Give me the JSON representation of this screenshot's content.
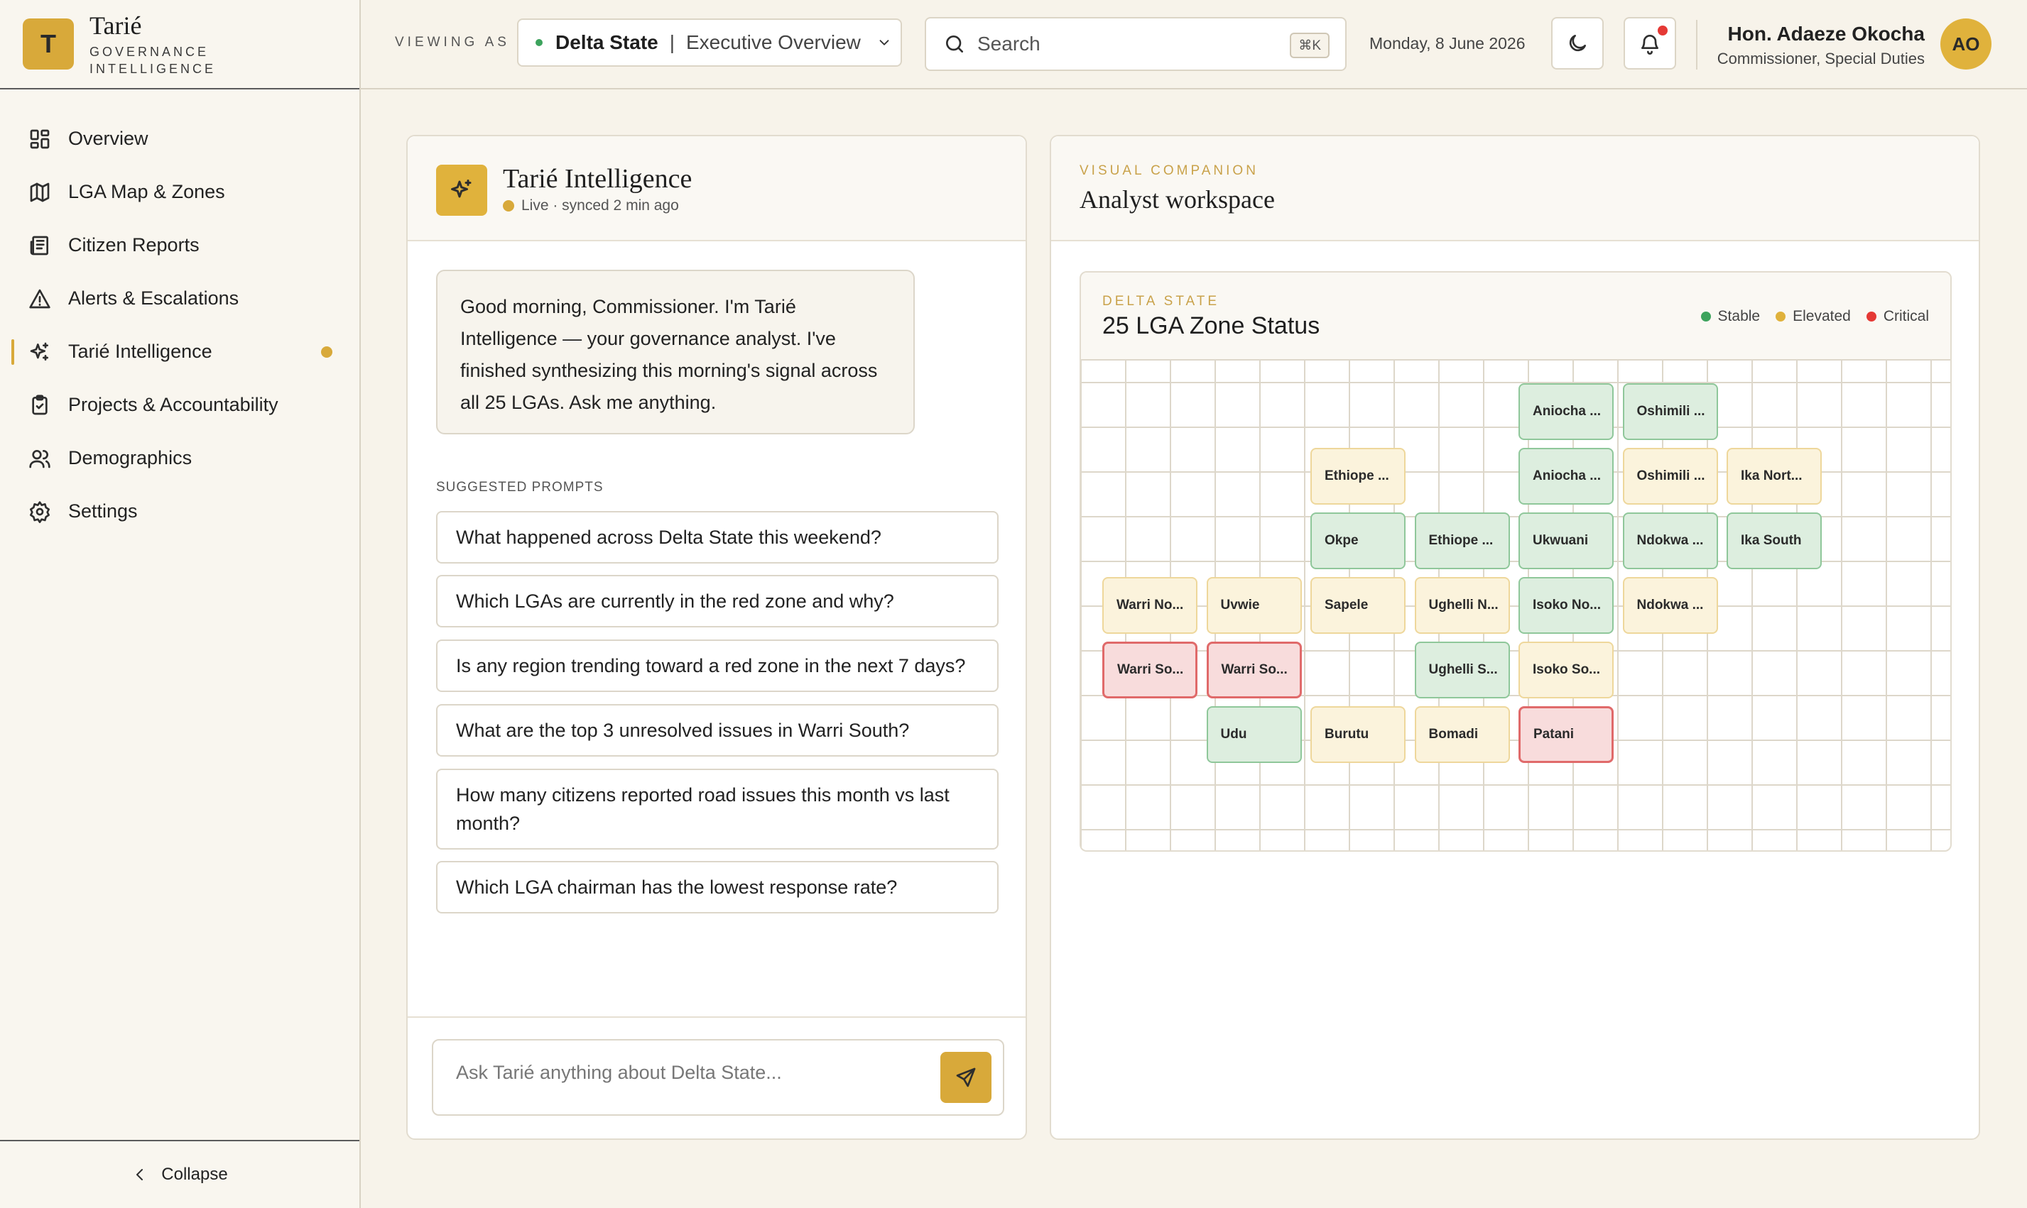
{
  "app": {
    "brand_initial": "T",
    "brand_name": "Tarié",
    "brand_sub": "GOVERNANCE INTELLIGENCE"
  },
  "sidebar": {
    "items": [
      {
        "label": "Overview",
        "icon": "dashboard-grid-icon"
      },
      {
        "label": "LGA Map & Zones",
        "icon": "map-icon"
      },
      {
        "label": "Citizen Reports",
        "icon": "newspaper-icon"
      },
      {
        "label": "Alerts & Escalations",
        "icon": "alert-triangle-icon"
      },
      {
        "label": "Tarié Intelligence",
        "icon": "sparkles-icon",
        "active": true
      },
      {
        "label": "Projects & Accountability",
        "icon": "clipboard-check-icon"
      },
      {
        "label": "Demographics",
        "icon": "users-icon"
      },
      {
        "label": "Settings",
        "icon": "gear-icon"
      }
    ],
    "collapse_label": "Collapse"
  },
  "header": {
    "viewing_as": "VIEWING AS",
    "scope_state": "Delta State",
    "scope_view": "Executive Overview",
    "search_placeholder": "Search",
    "search_shortcut": "⌘K",
    "date": "Monday, 8 June 2026",
    "user_name": "Hon. Adaeze Okocha",
    "user_role": "Commissioner, Special Duties",
    "user_initials": "AO"
  },
  "chat": {
    "title": "Tarié Intelligence",
    "status": "Live · synced 2 min ago",
    "greeting": "Good morning, Commissioner. I'm Tarié Intelligence — your governance analyst. I've finished synthesizing this morning's signal across all 25 LGAs. Ask me anything.",
    "prompts_label": "SUGGESTED PROMPTS",
    "prompts": [
      "What happened across Delta State this weekend?",
      "Which LGAs are currently in the red zone and why?",
      "Is any region trending toward a red zone in the next 7 days?",
      "What are the top 3 unresolved issues in Warri South?",
      "How many citizens reported road issues this month vs last month?",
      "Which LGA chairman has the lowest response rate?"
    ],
    "input_placeholder": "Ask Tarié anything about Delta State..."
  },
  "workspace": {
    "eyebrow": "VISUAL COMPANION",
    "title": "Analyst workspace",
    "grid_eyebrow": "DELTA STATE",
    "grid_title": "25 LGA Zone Status",
    "legend": [
      {
        "label": "Stable",
        "color": "#3DA35D"
      },
      {
        "label": "Elevated",
        "color": "#E0B23C"
      },
      {
        "label": "Critical",
        "color": "#E53935"
      }
    ],
    "lgas": [
      {
        "name": "Aniocha ...",
        "status": "stable",
        "col": 5,
        "row": 0
      },
      {
        "name": "Oshimili ...",
        "status": "stable",
        "col": 6,
        "row": 0
      },
      {
        "name": "Ethiope ...",
        "status": "elevated",
        "col": 3,
        "row": 1
      },
      {
        "name": "Aniocha ...",
        "status": "stable",
        "col": 5,
        "row": 1
      },
      {
        "name": "Oshimili ...",
        "status": "elevated",
        "col": 6,
        "row": 1
      },
      {
        "name": "Ika Nort...",
        "status": "elevated",
        "col": 7,
        "row": 1
      },
      {
        "name": "Okpe",
        "status": "stable",
        "col": 3,
        "row": 2
      },
      {
        "name": "Ethiope ...",
        "status": "stable",
        "col": 4,
        "row": 2
      },
      {
        "name": "Ukwuani",
        "status": "stable",
        "col": 5,
        "row": 2
      },
      {
        "name": "Ndokwa ...",
        "status": "stable",
        "col": 6,
        "row": 2
      },
      {
        "name": "Ika South",
        "status": "stable",
        "col": 7,
        "row": 2
      },
      {
        "name": "Warri No...",
        "status": "elevated",
        "col": 1,
        "row": 3
      },
      {
        "name": "Uvwie",
        "status": "elevated",
        "col": 2,
        "row": 3
      },
      {
        "name": "Sapele",
        "status": "elevated",
        "col": 3,
        "row": 3
      },
      {
        "name": "Ughelli N...",
        "status": "elevated",
        "col": 4,
        "row": 3
      },
      {
        "name": "Isoko No...",
        "status": "stable",
        "col": 5,
        "row": 3
      },
      {
        "name": "Ndokwa ...",
        "status": "elevated",
        "col": 6,
        "row": 3
      },
      {
        "name": "Warri So...",
        "status": "critical",
        "col": 1,
        "row": 4
      },
      {
        "name": "Warri So...",
        "status": "critical",
        "col": 2,
        "row": 4
      },
      {
        "name": "Ughelli S...",
        "status": "stable",
        "col": 4,
        "row": 4
      },
      {
        "name": "Isoko So...",
        "status": "elevated",
        "col": 5,
        "row": 4
      },
      {
        "name": "Udu",
        "status": "stable",
        "col": 2,
        "row": 5
      },
      {
        "name": "Burutu",
        "status": "elevated",
        "col": 3,
        "row": 5
      },
      {
        "name": "Bomadi",
        "status": "elevated",
        "col": 4,
        "row": 5
      },
      {
        "name": "Patani",
        "status": "critical",
        "col": 5,
        "row": 5
      }
    ]
  }
}
